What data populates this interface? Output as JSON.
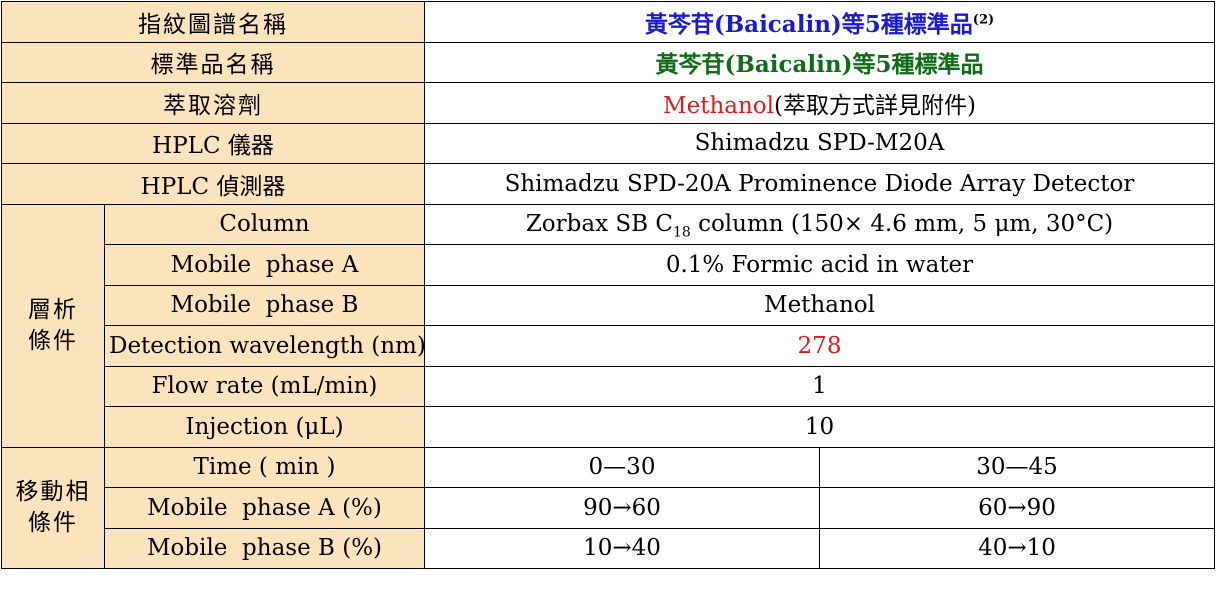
{
  "colors": {
    "label_bg": "#fbe4bd",
    "value_bg": "#ffffff",
    "title_blue": "#1a1ad6",
    "title_green": "#0f6b17",
    "highlight_red": "#e01a1a"
  },
  "rows": {
    "fingerprint_name": {
      "label": "指紋圖譜名稱",
      "value": "黃芩苷(Baicalin)等5種標準品",
      "footnote": "(2)"
    },
    "standard_name": {
      "label": "標準品名稱",
      "value": "黃芩苷(Baicalin)等5種標準品"
    },
    "solvent": {
      "label": "萃取溶劑",
      "value_red": "Methanol",
      "value_rest": "(萃取方式詳見附件)"
    },
    "instrument": {
      "label": "HPLC 儀器",
      "value": "Shimadzu SPD-M20A"
    },
    "detector": {
      "label": "HPLC 偵測器",
      "value": "Shimadzu SPD-20A Prominence Diode Array Detector"
    }
  },
  "analysis": {
    "group_label_line1": "層析",
    "group_label_line2": "條件",
    "column": {
      "label": "Column",
      "value_prefix": "Zorbax SB C",
      "value_sub": "18",
      "value_suffix": " column (150× 4.6 mm, 5 μm, 30°C)"
    },
    "mobile_a": {
      "label": "Mobile  phase A",
      "value": "0.1% Formic acid in water"
    },
    "mobile_b": {
      "label": "Mobile  phase B",
      "value": "Methanol"
    },
    "wavelength": {
      "label": "Detection wavelength (nm)",
      "value": "278"
    },
    "flow_rate": {
      "label": "Flow rate (mL/min)",
      "value": "1"
    },
    "injection": {
      "label": "Injection (μL)",
      "value": "10"
    }
  },
  "gradient": {
    "group_label_line1": "移動相",
    "group_label_line2": "條件",
    "time": {
      "label": "Time ( min )",
      "col1": "0—30",
      "col2": "30—45"
    },
    "phase_a": {
      "label": "Mobile  phase A (%)",
      "col1": "90→60",
      "col2": "60→90"
    },
    "phase_b": {
      "label": "Mobile  phase B (%)",
      "col1": "10→40",
      "col2": "40→10"
    }
  }
}
